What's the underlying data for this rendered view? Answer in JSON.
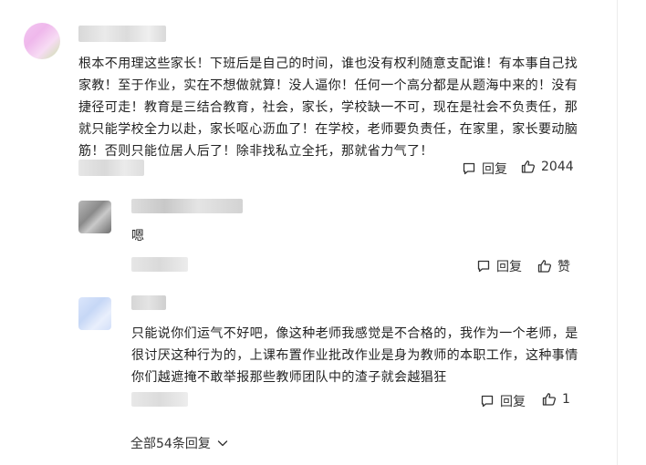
{
  "comments": [
    {
      "text_lines": [
        "根本不用理这些家长！下班后是自己的时间，谁也没有权利随意支配谁！有本事自己找",
        "家教！至于作业，实在不想做就算！没人逼你！任何一个高分都是从题海中来的！没有",
        "捷径可走！教育是三结合教育，社会，家长，学校缺一不可，现在是社会不负责任，那",
        "就只能学校全力以赴，家长呕心沥血了！在学校，老师要负责任，在家里，家长要动脑",
        "筋！否则只能位居人后了！除非找私立全托，那就省力气了！"
      ],
      "reply_label": "回复",
      "like_count": "2044"
    },
    {
      "text": "嗯",
      "reply_label": "回复",
      "like_label": "赞"
    },
    {
      "text_lines": [
        "只能说你们运气不好吧，像这种老师我感觉是不合格的，我作为一个老师，是",
        "很讨厌这种行为的，上课布置作业批改作业是身为教师的本职工作，这种事情",
        "你们越遮掩不敢举报那些教师团队中的渣子就会越猖狂"
      ],
      "reply_label": "回复",
      "like_count": "1"
    }
  ],
  "more_replies_label": "全部54条回复",
  "icons": {
    "reply": "comment-bubble-icon",
    "like": "thumbs-up-icon",
    "expand": "chevron-down-icon"
  },
  "colors": {
    "text": "#222222",
    "action": "#333333",
    "blur": "#e3e3e3"
  }
}
